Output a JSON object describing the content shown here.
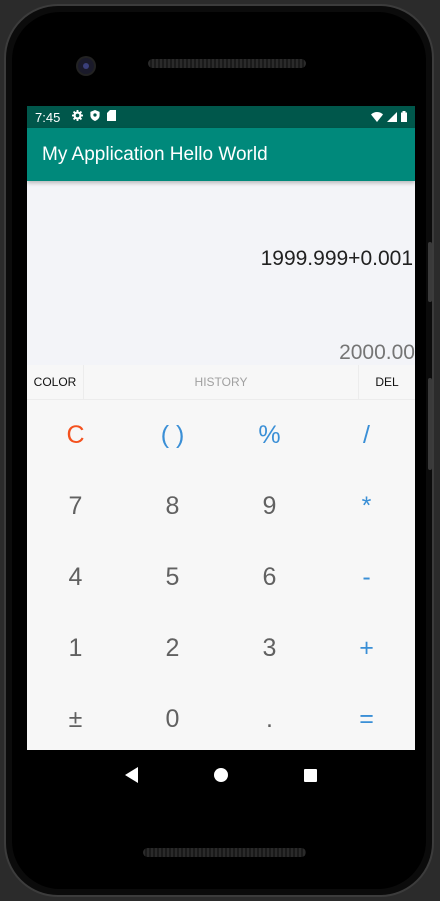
{
  "statusbar": {
    "time": "7:45"
  },
  "appbar": {
    "title": "My Application Hello World"
  },
  "display": {
    "expression": "1999.999+0.001",
    "result": "2000.00"
  },
  "tabs": {
    "color": "COLOR",
    "history": "HISTORY",
    "del": "DEL"
  },
  "keys": [
    {
      "label": "C",
      "type": "clear",
      "name": "clear-button"
    },
    {
      "label": "( )",
      "type": "op",
      "name": "parentheses-button"
    },
    {
      "label": "%",
      "type": "op",
      "name": "percent-button"
    },
    {
      "label": "/",
      "type": "op",
      "name": "divide-button"
    },
    {
      "label": "7",
      "type": "num",
      "name": "digit-7-button"
    },
    {
      "label": "8",
      "type": "num",
      "name": "digit-8-button"
    },
    {
      "label": "9",
      "type": "num",
      "name": "digit-9-button"
    },
    {
      "label": "*",
      "type": "op",
      "name": "multiply-button"
    },
    {
      "label": "4",
      "type": "num",
      "name": "digit-4-button"
    },
    {
      "label": "5",
      "type": "num",
      "name": "digit-5-button"
    },
    {
      "label": "6",
      "type": "num",
      "name": "digit-6-button"
    },
    {
      "label": "-",
      "type": "op",
      "name": "subtract-button"
    },
    {
      "label": "1",
      "type": "num",
      "name": "digit-1-button"
    },
    {
      "label": "2",
      "type": "num",
      "name": "digit-2-button"
    },
    {
      "label": "3",
      "type": "num",
      "name": "digit-3-button"
    },
    {
      "label": "+",
      "type": "op",
      "name": "add-button"
    },
    {
      "label": "±",
      "type": "num",
      "name": "plus-minus-button"
    },
    {
      "label": "0",
      "type": "num",
      "name": "digit-0-button"
    },
    {
      "label": ".",
      "type": "num",
      "name": "decimal-button"
    },
    {
      "label": "=",
      "type": "op",
      "name": "equals-button"
    }
  ],
  "colors": {
    "statusbar": "#00574b",
    "appbar": "#00897b",
    "operator": "#3a8fd6",
    "clear": "#f4511e",
    "digit": "#616161"
  },
  "icons": [
    "settings-icon",
    "shield-icon",
    "sd-card-icon",
    "wifi-icon",
    "signal-icon",
    "battery-icon",
    "back-icon",
    "home-icon",
    "recents-icon"
  ]
}
